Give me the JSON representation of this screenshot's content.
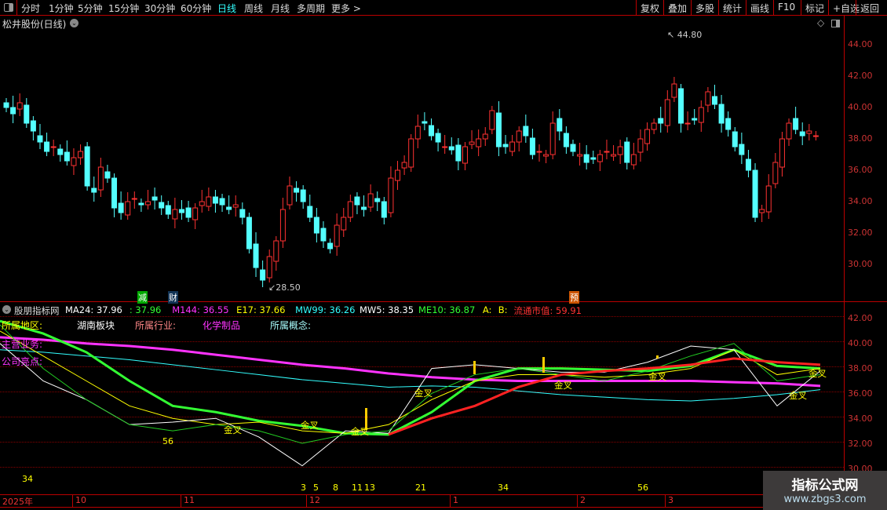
{
  "toolbar": {
    "tabs": [
      "分时",
      "1分钟",
      "5分钟",
      "15分钟",
      "30分钟",
      "60分钟",
      "日线",
      "周线",
      "月线",
      "多周期",
      "更多 >"
    ],
    "active": "日线",
    "buttons": [
      "复权",
      "叠加",
      "多股",
      "统计",
      "画线",
      "F10",
      "标记",
      "+自选",
      "返回"
    ]
  },
  "stock": {
    "title": "松井股份(日线)",
    "high_label": "44.80",
    "low_label": "28.50",
    "markers": [
      "减",
      "财",
      "预"
    ]
  },
  "price_axis": [
    "44.00",
    "42.00",
    "40.00",
    "38.00",
    "36.00",
    "34.00",
    "32.00",
    "30.00"
  ],
  "indicator": {
    "name": "股朋指标网",
    "values": [
      {
        "label": "MA24: 37.96",
        "color": "#ffffff"
      },
      {
        "label": ": 37.96",
        "color": "#33ff33"
      },
      {
        "label": "M144: 36.55",
        "color": "#ff33ff"
      },
      {
        "label": "E17: 37.66",
        "color": "#ffff00"
      },
      {
        "label": "MW99: 36.26",
        "color": "#33ffff"
      },
      {
        "label": "MW5: 38.35",
        "color": "#ffffff"
      },
      {
        "label": "ME10: 36.87",
        "color": "#33ff33"
      },
      {
        "label": "A:",
        "color": "#ffff00"
      },
      {
        "label": "B:",
        "color": "#ffff00"
      },
      {
        "label": "流通市值: 59.91",
        "color": "#ff3333"
      }
    ],
    "info": {
      "region_label": "所属地区:",
      "region": "湖南板块",
      "industry_label": "所属行业:",
      "industry": "化学制品",
      "concept_label": "所属概念:",
      "business_label": "主营业务:",
      "highlight_label": "公司亮点:"
    },
    "axis": [
      "42.00",
      "40.00",
      "38.00",
      "36.00",
      "34.00",
      "32.00",
      "30.00"
    ],
    "cross_label": "金叉",
    "fib_numbers": [
      "56",
      "34",
      "3",
      "5",
      "8",
      "11",
      "13",
      "21",
      "34",
      "56"
    ]
  },
  "time_axis": [
    "2025年",
    "10",
    "11",
    "12",
    "1",
    "2",
    "3"
  ],
  "watermark": {
    "title": "指标公式网",
    "url": "www.zbgs3.com"
  },
  "closes": [
    40,
    39.6,
    40.3,
    39,
    38.5,
    37.8,
    37.2,
    37.5,
    37,
    36.6,
    36.8,
    37.2,
    35,
    34.6,
    36.2,
    35.5,
    33.6,
    33.3,
    34,
    34.2,
    33.8,
    34,
    34.1,
    33.6,
    33.2,
    33.5,
    33.3,
    33,
    33.6,
    34,
    34.3,
    33.9,
    33.8,
    33.5,
    33.8,
    33,
    31,
    29.8,
    29,
    30.5,
    31.5,
    33.5,
    35,
    34.6,
    34,
    33,
    32,
    31.5,
    31,
    32.5,
    33,
    34,
    33.8,
    33.5,
    34.5,
    34,
    33,
    35.5,
    36,
    36.5,
    38,
    38.8,
    39,
    38.2,
    37.8,
    37.5,
    37.3,
    36.6,
    37.5,
    37.8,
    38,
    38.3,
    39.8,
    37.5,
    37.5,
    37.8,
    38.5,
    38.2,
    37,
    37.2,
    37,
    39,
    38.5,
    37.5,
    37.2,
    37,
    36.5,
    36.7,
    37,
    37.2,
    37,
    37.5,
    36.5,
    37,
    38,
    38.6,
    39,
    39,
    40.5,
    41.5,
    39,
    39,
    39.2,
    40,
    41,
    40.2,
    39,
    38.6,
    37.5,
    37,
    36,
    33,
    33.5,
    35,
    36.5,
    38,
    39,
    38.6,
    38.2,
    38.5,
    38.2
  ],
  "series": {
    "M144": {
      "color": "#ff33ff",
      "v": [
        40.5,
        40.3,
        40,
        39.8,
        39.5,
        39.1,
        38.7,
        38.3,
        38,
        37.6,
        37.3,
        37.1,
        37,
        37,
        37,
        37,
        37,
        36.9,
        36.8,
        36.6
      ]
    },
    "MW99": {
      "color": "#33ffff",
      "v": [
        39.5,
        39.3,
        39,
        38.7,
        38.3,
        37.9,
        37.5,
        37.1,
        36.8,
        36.5,
        36.6,
        36.5,
        36.2,
        35.9,
        35.7,
        35.5,
        35.4,
        35.6,
        35.9,
        36.3
      ]
    },
    "MA24": {
      "color": "#33ff33",
      "v": [
        41.8,
        40.8,
        39.3,
        37,
        35,
        34.5,
        33.8,
        33.4,
        32.8,
        32.7,
        34.5,
        37,
        38,
        38,
        37.9,
        37.8,
        38.2,
        39.5,
        38.2,
        38
      ]
    },
    "E17": {
      "color": "#ffff00",
      "v": [
        41,
        39,
        37,
        35,
        34,
        33.5,
        33.7,
        33,
        32.8,
        33.5,
        35.5,
        37,
        37.5,
        37.5,
        37.3,
        37.5,
        38,
        39.5,
        37.5,
        38
      ]
    },
    "MW5": {
      "color": "#ffffff",
      "v": [
        40,
        37,
        35.5,
        33.5,
        33.7,
        34,
        32.5,
        30.2,
        33,
        32.8,
        38,
        38.3,
        38,
        37.7,
        37.7,
        38.5,
        39.8,
        39.5,
        35,
        37.8
      ]
    },
    "ME10": {
      "color": "#22cc22",
      "v": [
        41.5,
        38,
        35.5,
        33.5,
        33,
        33.5,
        33,
        32,
        32.7,
        33,
        36,
        37.5,
        38,
        37.5,
        37,
        37.8,
        39,
        40,
        37,
        37.5
      ]
    },
    "RED": {
      "color": "#ff2222",
      "v": [
        null,
        null,
        null,
        null,
        null,
        null,
        null,
        null,
        null,
        32.7,
        34,
        35,
        36.5,
        37.5,
        37.8,
        38,
        38.3,
        38.8,
        38.5,
        38.3
      ]
    }
  }
}
